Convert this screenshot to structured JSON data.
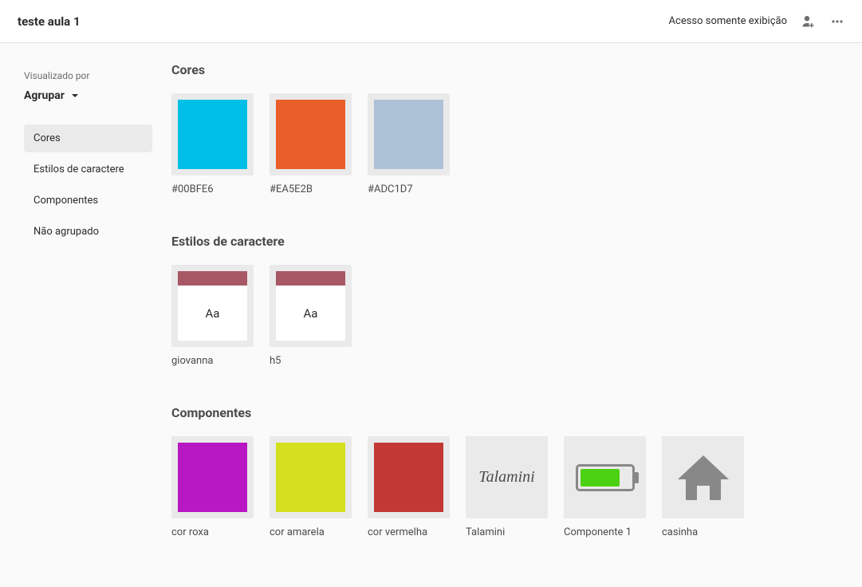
{
  "header": {
    "title": "teste aula 1",
    "access_label": "Acesso somente exibição"
  },
  "sidebar": {
    "viewed_by_label": "Visualizado por",
    "group_label": "Agrupar",
    "nav": [
      {
        "label": "Cores",
        "active": true
      },
      {
        "label": "Estilos de caractere",
        "active": false
      },
      {
        "label": "Componentes",
        "active": false
      },
      {
        "label": "Não agrupado",
        "active": false
      }
    ]
  },
  "sections": {
    "colors": {
      "title": "Cores",
      "items": [
        {
          "label": "#00BFE6",
          "hex": "#00BFE6"
        },
        {
          "label": "#EA5E2B",
          "hex": "#EA5E2B"
        },
        {
          "label": "#ADC1D7",
          "hex": "#ADC1D7"
        }
      ]
    },
    "char_styles": {
      "title": "Estilos de caractere",
      "sample": "Aa",
      "items": [
        {
          "label": "giovanna"
        },
        {
          "label": "h5"
        }
      ]
    },
    "components": {
      "title": "Componentes",
      "items": [
        {
          "label": "cor roxa",
          "type": "swatch",
          "hex": "#B818C4"
        },
        {
          "label": "cor amarela",
          "type": "swatch",
          "hex": "#D4E01E"
        },
        {
          "label": "cor vermelha",
          "type": "swatch",
          "hex": "#C23934"
        },
        {
          "label": "Talamini",
          "type": "talamini",
          "text": "Talamini"
        },
        {
          "label": "Componente 1",
          "type": "battery"
        },
        {
          "label": "casinha",
          "type": "house"
        }
      ]
    }
  }
}
